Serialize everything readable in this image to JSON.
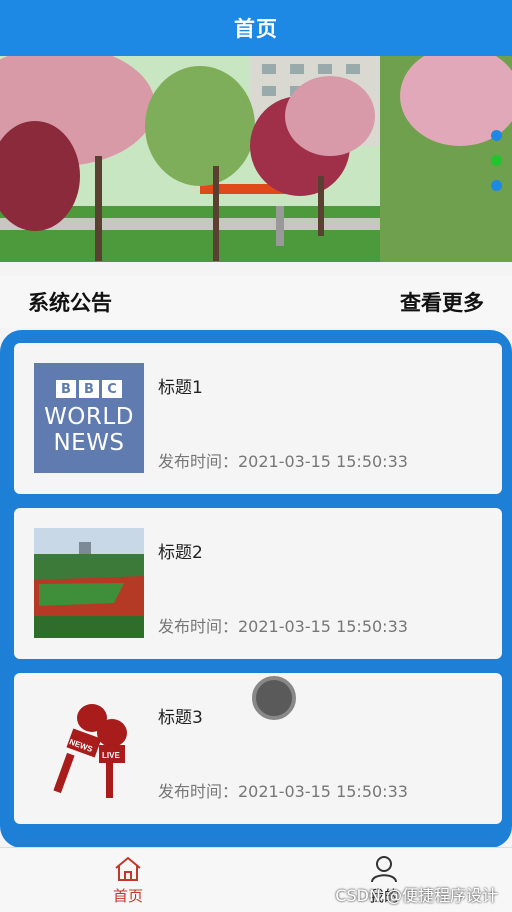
{
  "header": {
    "title": "首页"
  },
  "carousel": {
    "dots": 3,
    "active_index": 1
  },
  "notice": {
    "title": "系统公告",
    "more_label": "查看更多"
  },
  "list": [
    {
      "title": "标题1",
      "time": "发布时间：2021-03-15 15:50:33",
      "thumb": "bbc-world-news"
    },
    {
      "title": "标题2",
      "time": "发布时间：2021-03-15 15:50:33",
      "thumb": "sports-field"
    },
    {
      "title": "标题3",
      "time": "发布时间：2021-03-15 15:50:33",
      "thumb": "news-microphones"
    }
  ],
  "bbc": {
    "box1": "B",
    "box2": "B",
    "box3": "C",
    "line1": "WORLD",
    "line2": "NEWS"
  },
  "mic": {
    "text1": "NEWS",
    "text2": "LIVE"
  },
  "tabbar": {
    "home_label": "首页",
    "me_label": "我的",
    "active": "home",
    "active_color": "#c0392b"
  },
  "watermark": "CSDN @便捷程序设计",
  "colors": {
    "primary": "#1e88e5",
    "dot_active": "#22c52e"
  }
}
